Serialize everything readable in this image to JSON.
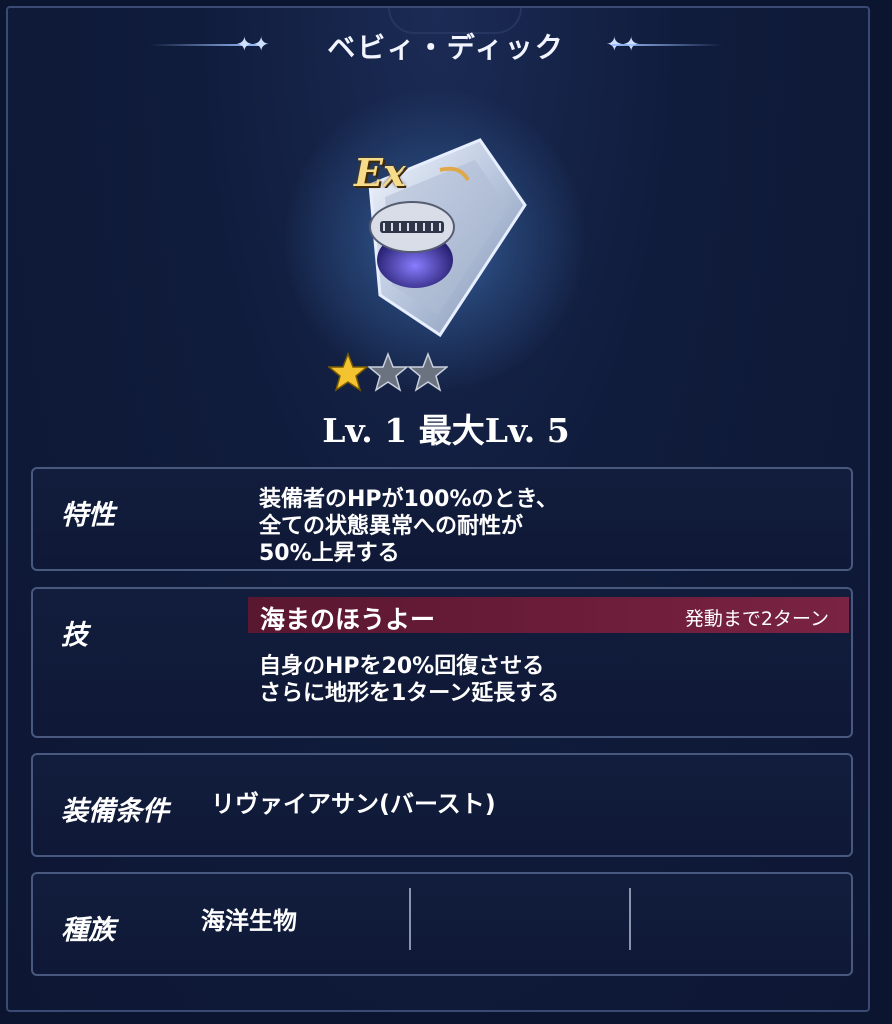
{
  "title": "ベビィ・ディック",
  "item": {
    "badge": "Ex",
    "icon": "shield-with-whale-icon",
    "stars_filled": 1,
    "stars_total": 3,
    "level_text": "Lv. 1  最大Lv. 5"
  },
  "trait": {
    "label": "特性",
    "lines": [
      "装備者のHPが100%のとき、",
      "全ての状態異常への耐性が",
      "50%上昇する"
    ]
  },
  "skill": {
    "label": "技",
    "name": "海まのほうよー",
    "cooldown": "発動まで2ターン",
    "lines": [
      "自身のHPを20%回復させる",
      "さらに地形を1ターン延長する"
    ]
  },
  "equip": {
    "label": "装備条件",
    "value": "リヴァイアサン(バースト)"
  },
  "race": {
    "label": "種族",
    "value": "海洋生物"
  },
  "colors": {
    "background": "#0d1734",
    "panel_border": "#48587e",
    "skill_bar": "#6e1d3a",
    "star_gold": "#f4c430",
    "star_gray": "#6b7280"
  }
}
